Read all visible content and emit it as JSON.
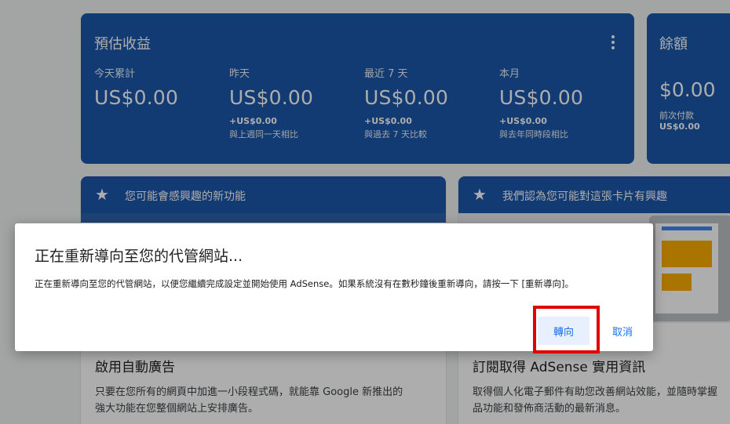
{
  "earnings": {
    "title": "預估收益",
    "stats": [
      {
        "label": "今天累計",
        "amount": "US$0.00",
        "change": "",
        "compare": ""
      },
      {
        "label": "昨天",
        "amount": "US$0.00",
        "change": "+US$0.00",
        "compare": "與上週同一天相比"
      },
      {
        "label": "最近 7 天",
        "amount": "US$0.00",
        "change": "+US$0.00",
        "compare": "與過去 7 天比較"
      },
      {
        "label": "本月",
        "amount": "US$0.00",
        "change": "+US$0.00",
        "compare": "與去年同時段相比"
      }
    ]
  },
  "balance": {
    "title": "餘額",
    "amount": "$0.00",
    "next_payment_label": "前次付款",
    "next_payment_value": "US$0.00"
  },
  "feature_card": {
    "header": "您可能會感興趣的新功能",
    "title": "啟用自動廣告",
    "body_line1": "只要在您所有的網頁中加進一小段程式碼，就能靠 Google 新推出的",
    "body_line2": "強大功能在您整個網站上安排廣告。"
  },
  "tips_card": {
    "header": "我們認為您可能對這張卡片有興趣",
    "title": "訂閱取得 AdSense 實用資訊",
    "body_line1": "取得個人化電子郵件有助您改善網站效能，並隨時掌握",
    "body_line2": "品功能和發佈商活動的最新消息。"
  },
  "dialog": {
    "title": "正在重新導向至您的代管網站...",
    "message": "正在重新導向至您的代管網站，以便您繼續完成設定並開始使用 AdSense。如果系統沒有在數秒鐘後重新導向，請按一下 [重新導向]。",
    "redirect_label": "轉向",
    "cancel_label": "取消"
  },
  "icons": {
    "star": "star-icon",
    "more": "more-vert-icon"
  },
  "colors": {
    "brand_blue": "#1a57a8",
    "link_blue": "#1a73e8",
    "highlight_red": "#e00000"
  }
}
